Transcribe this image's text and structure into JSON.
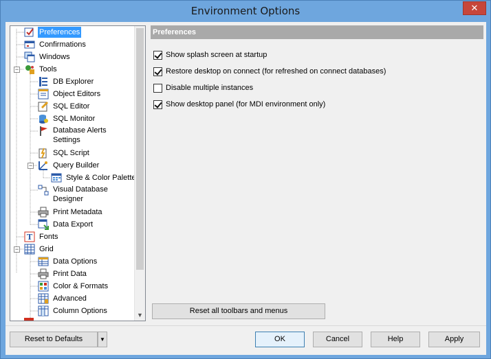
{
  "window": {
    "title": "Environment Options",
    "close_glyph": "✕"
  },
  "tree": {
    "items": [
      {
        "label": "Preferences",
        "icon": "preferences-icon",
        "selected": true
      },
      {
        "label": "Confirmations",
        "icon": "confirmations-icon"
      },
      {
        "label": "Windows",
        "icon": "windows-icon"
      },
      {
        "label": "Tools",
        "icon": "tools-icon"
      },
      {
        "label": "DB Explorer",
        "icon": "db-explorer-icon"
      },
      {
        "label": "Object Editors",
        "icon": "object-editors-icon"
      },
      {
        "label": "SQL Editor",
        "icon": "sql-editor-icon"
      },
      {
        "label": "SQL Monitor",
        "icon": "sql-monitor-icon"
      },
      {
        "label": "Database Alerts\nSettings",
        "icon": "database-alerts-icon"
      },
      {
        "label": "SQL Script",
        "icon": "sql-script-icon"
      },
      {
        "label": "Query Builder",
        "icon": "query-builder-icon"
      },
      {
        "label": "Style & Color Palette",
        "icon": "style-color-palette-icon"
      },
      {
        "label": "Visual Database\nDesigner",
        "icon": "visual-database-designer-icon"
      },
      {
        "label": "Print Metadata",
        "icon": "print-metadata-icon"
      },
      {
        "label": "Data Export",
        "icon": "data-export-icon"
      },
      {
        "label": "Fonts",
        "icon": "fonts-icon"
      },
      {
        "label": "Grid",
        "icon": "grid-icon"
      },
      {
        "label": "Data Options",
        "icon": "data-options-icon"
      },
      {
        "label": "Print Data",
        "icon": "print-data-icon"
      },
      {
        "label": "Color & Formats",
        "icon": "color-formats-icon"
      },
      {
        "label": "Advanced",
        "icon": "advanced-icon"
      },
      {
        "label": "Column Options",
        "icon": "column-options-icon"
      }
    ],
    "expander_minus": "−"
  },
  "preferences": {
    "header": "Preferences",
    "options": [
      {
        "label": "Show splash screen at startup",
        "checked": true
      },
      {
        "label": "Restore desktop on connect (for refreshed on connect databases)",
        "checked": true
      },
      {
        "label": "Disable multiple instances",
        "checked": false
      },
      {
        "label": "Show desktop panel (for MDI environment only)",
        "checked": true
      }
    ],
    "reset_toolbars_label": "Reset all toolbars and menus"
  },
  "footer": {
    "reset_defaults_label": "Reset to Defaults",
    "ok_label": "OK",
    "cancel_label": "Cancel",
    "help_label": "Help",
    "apply_label": "Apply",
    "dropdown_glyph": "▼"
  },
  "colors": {
    "selection": "#3399ff",
    "header_bg": "#a9a9a9",
    "titlebar": "#6ea6de",
    "close_button": "#c7463a"
  }
}
